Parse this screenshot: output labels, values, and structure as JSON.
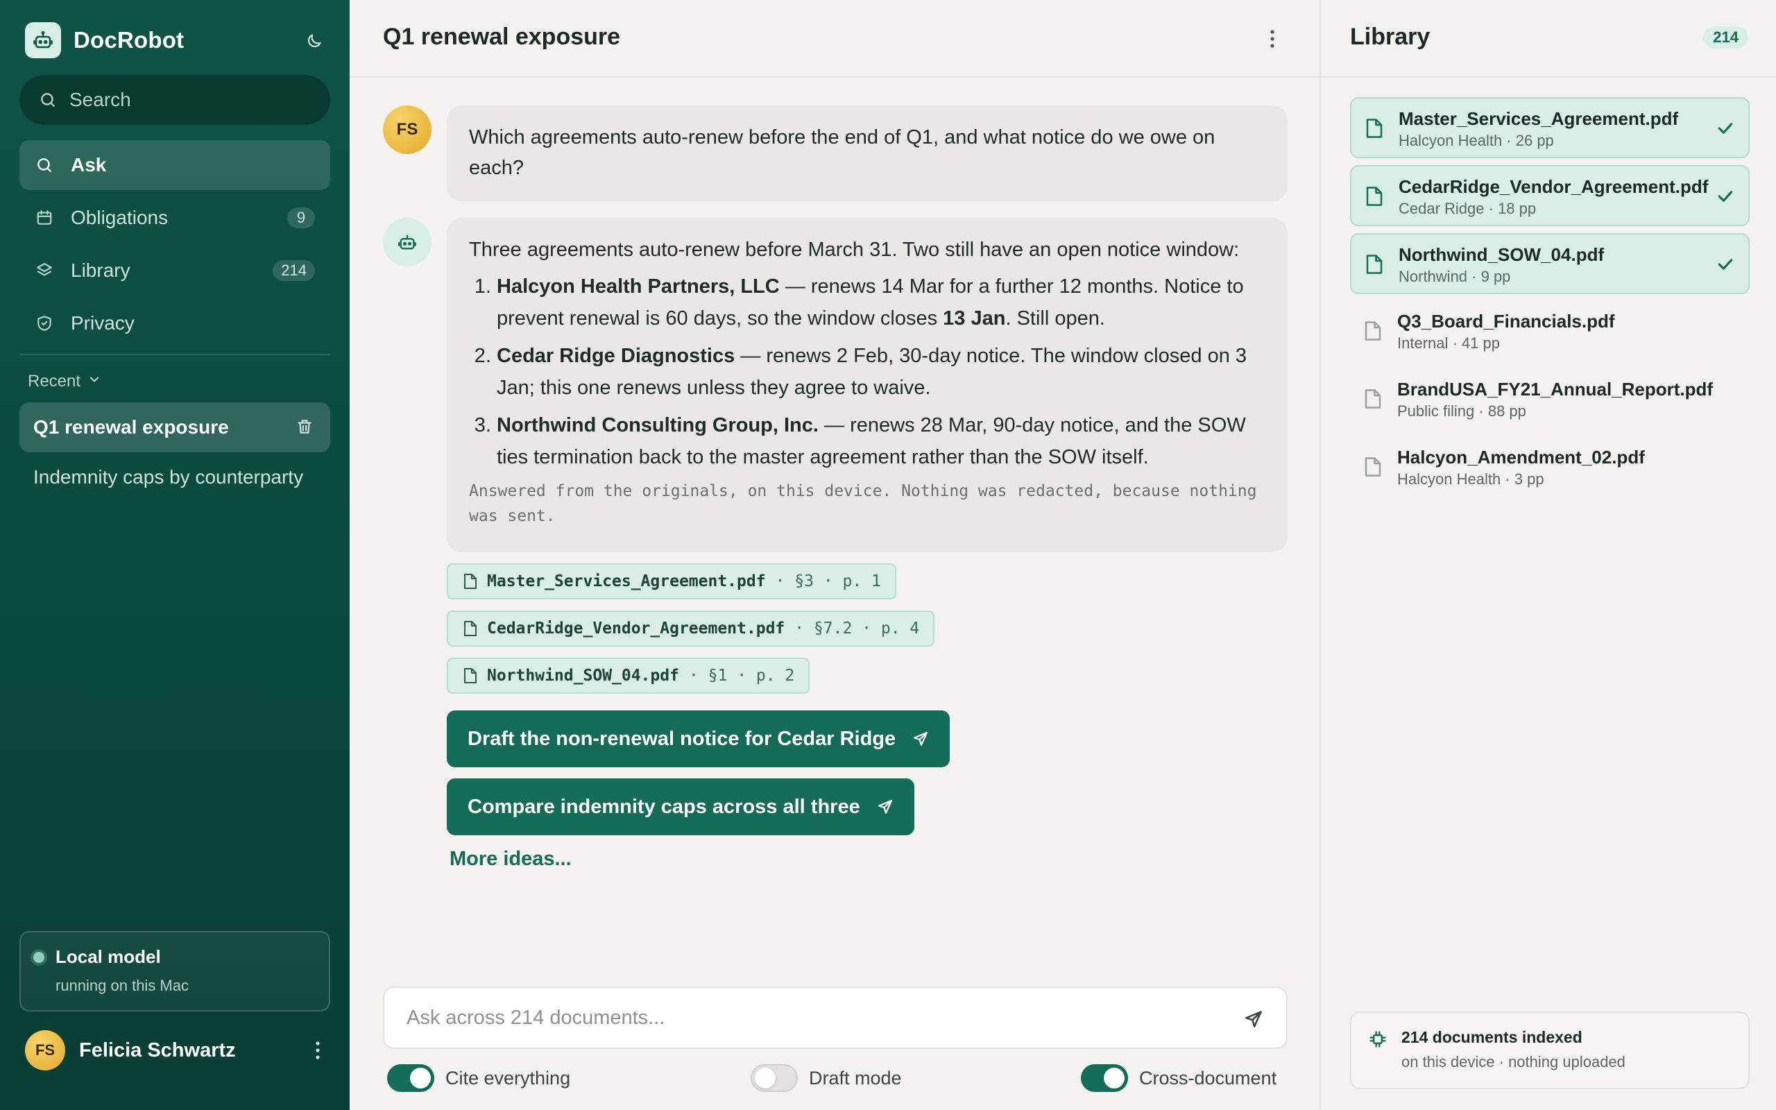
{
  "app": {
    "name": "DocRobot"
  },
  "sidebar": {
    "search_label": "Search",
    "nav": [
      {
        "label": "Ask",
        "icon": "search-icon",
        "badge": ""
      },
      {
        "label": "Obligations",
        "icon": "calendar-icon",
        "badge": "9"
      },
      {
        "label": "Library",
        "icon": "layers-icon",
        "badge": "214"
      },
      {
        "label": "Privacy",
        "icon": "shield-icon",
        "badge": ""
      }
    ],
    "recent_header": "Recent",
    "recent": [
      {
        "label": "Q1 renewal exposure"
      },
      {
        "label": "Indemnity caps by counterparty"
      }
    ],
    "model": {
      "title": "Local model",
      "subtitle": "running on this Mac"
    },
    "user": {
      "initials": "FS",
      "name": "Felicia Schwartz"
    }
  },
  "chat": {
    "title": "Q1 renewal exposure",
    "user_initials": "FS",
    "question": "Which agreements auto-renew before the end of Q1, and what notice do we owe on each?",
    "answer": {
      "intro": "Three agreements auto-renew before March 31. Two still have an open notice window:",
      "items": [
        {
          "name": "Halcyon Health Partners, LLC",
          "text_a": " — renews 14 Mar for a further 12 months. Notice to prevent renewal is 60 days, so the window closes ",
          "strong": "13 Jan",
          "text_b": ". Still open."
        },
        {
          "name": "Cedar Ridge Diagnostics",
          "text_a": " — renews 2 Feb, 30-day notice. The window closed on 3 Jan; this one renews unless they agree to waive.",
          "strong": "",
          "text_b": ""
        },
        {
          "name": "Northwind Consulting Group, Inc.",
          "text_a": " — renews 28 Mar, 90-day notice, and the SOW ties termination back to the master agreement rather than the SOW itself.",
          "strong": "",
          "text_b": ""
        }
      ],
      "note": "Answered from the originals, on this device. Nothing was redacted, because nothing was sent."
    },
    "citations": [
      {
        "file": "Master_Services_Agreement.pdf",
        "loc": "· §3 · p. 1"
      },
      {
        "file": "CedarRidge_Vendor_Agreement.pdf",
        "loc": "· §7.2 · p. 4"
      },
      {
        "file": "Northwind_SOW_04.pdf",
        "loc": "· §1 · p. 2"
      }
    ],
    "actions": [
      {
        "label": "Draft the non-renewal notice for Cedar Ridge"
      },
      {
        "label": "Compare indemnity caps across all three"
      }
    ],
    "more_ideas": "More ideas...",
    "composer_placeholder": "Ask across 214 documents...",
    "toggles": [
      {
        "label": "Cite everything",
        "on": true
      },
      {
        "label": "Draft mode",
        "on": false
      },
      {
        "label": "Cross-document",
        "on": true
      }
    ]
  },
  "library": {
    "title": "Library",
    "count": "214",
    "docs": [
      {
        "name": "Master_Services_Agreement.pdf",
        "meta": "Halcyon Health · 26 pp",
        "selected": true
      },
      {
        "name": "CedarRidge_Vendor_Agreement.pdf",
        "meta": "Cedar Ridge · 18 pp",
        "selected": true
      },
      {
        "name": "Northwind_SOW_04.pdf",
        "meta": "Northwind · 9 pp",
        "selected": true
      },
      {
        "name": "Q3_Board_Financials.pdf",
        "meta": "Internal · 41 pp",
        "selected": false
      },
      {
        "name": "BrandUSA_FY21_Annual_Report.pdf",
        "meta": "Public filing · 88 pp",
        "selected": false
      },
      {
        "name": "Halcyon_Amendment_02.pdf",
        "meta": "Halcyon Health · 3 pp",
        "selected": false
      }
    ],
    "index": {
      "title": "214 documents indexed",
      "subtitle": "on this device · nothing uploaded"
    }
  },
  "colors": {
    "accent": "#146b58",
    "sidebar": "#0b4a3d",
    "chip": "#d9efe6"
  }
}
